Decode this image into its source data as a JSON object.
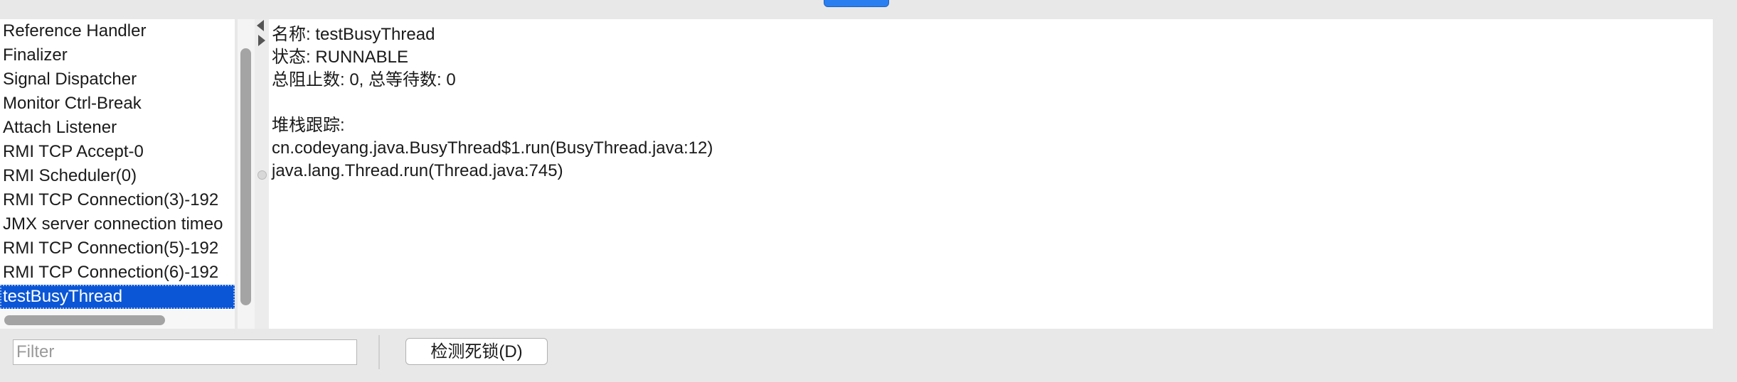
{
  "threads": {
    "items": [
      "Reference Handler",
      "Finalizer",
      "Signal Dispatcher",
      "Monitor Ctrl-Break",
      "Attach Listener",
      "RMI TCP Accept-0",
      "RMI Scheduler(0)",
      "RMI TCP Connection(3)-192",
      "JMX server connection timeo",
      "RMI TCP Connection(5)-192",
      "RMI TCP Connection(6)-192",
      "testBusyThread"
    ],
    "selected": "testBusyThread"
  },
  "detail": {
    "name_line": "名称: testBusyThread",
    "state_line": "状态: RUNNABLE",
    "counts_line": "总阻止数: 0, 总等待数: 0",
    "stack_header": "堆栈跟踪:",
    "stack_frames": [
      "cn.codeyang.java.BusyThread$1.run(BusyThread.java:12)",
      "java.lang.Thread.run(Thread.java:745)"
    ]
  },
  "bottom": {
    "filter_placeholder": "Filter",
    "deadlock_button_label": "检测死锁(D)"
  },
  "colors": {
    "selection": "#0a56d6",
    "top_button": "#2a7ef0"
  }
}
